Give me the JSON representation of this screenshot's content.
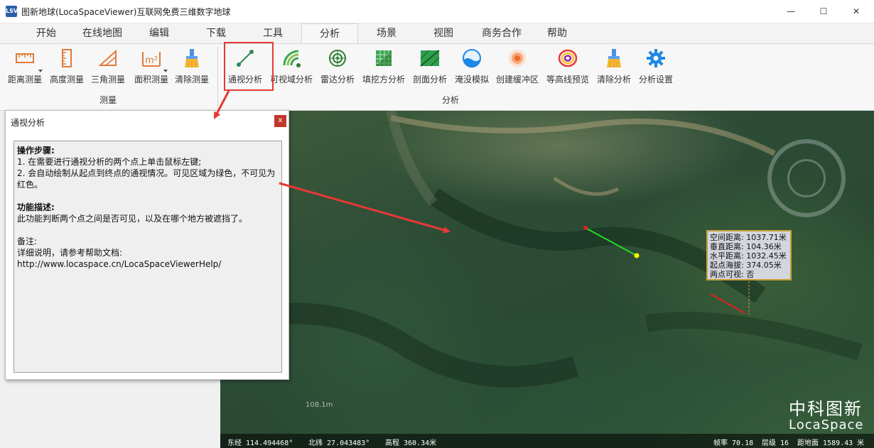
{
  "window": {
    "app_icon": "LSV",
    "title": "图新地球(LocaSpaceViewer)互联网免费三维数字地球",
    "minimize_glyph": "—",
    "maximize_glyph": "☐",
    "close_glyph": "✕"
  },
  "ribbon_tabs": [
    {
      "label": "开始"
    },
    {
      "label": "在线地图"
    },
    {
      "label": "编辑"
    },
    {
      "label": "下载"
    },
    {
      "label": "工具"
    },
    {
      "label": "分析",
      "active": true
    },
    {
      "label": "场景"
    },
    {
      "label": "视图"
    },
    {
      "label": "商务合作"
    },
    {
      "label": "帮助"
    }
  ],
  "measure_group": {
    "label": "测量",
    "buttons": [
      {
        "label": "距离测量",
        "icon": "ruler-icon"
      },
      {
        "label": "高度测量",
        "icon": "height-ruler-icon"
      },
      {
        "label": "三角测量",
        "icon": "triangle-ruler-icon"
      },
      {
        "label": "面积测量",
        "icon": "area-m2-icon"
      },
      {
        "label": "清除测量",
        "icon": "brush-clear-icon"
      }
    ],
    "area_icon_text": "m²"
  },
  "analysis_group": {
    "label": "分析",
    "buttons": [
      {
        "label": "通视分析",
        "icon": "line-of-sight-icon"
      },
      {
        "label": "可视域分析",
        "icon": "viewshed-icon"
      },
      {
        "label": "雷达分析",
        "icon": "radar-icon"
      },
      {
        "label": "填挖方分析",
        "icon": "cut-fill-icon"
      },
      {
        "label": "剖面分析",
        "icon": "profile-icon"
      },
      {
        "label": "淹没模拟",
        "icon": "flood-icon"
      },
      {
        "label": "创建缓冲区",
        "icon": "buffer-icon"
      },
      {
        "label": "等高线预览",
        "icon": "contour-icon"
      },
      {
        "label": "清除分析",
        "icon": "brush-clear-icon"
      },
      {
        "label": "分析设置",
        "icon": "gear-icon"
      }
    ]
  },
  "dialog": {
    "title": "通视分析",
    "close_label": "x",
    "steps_heading": "操作步骤:",
    "step1": "1. 在需要进行通视分析的两个点上单击鼠标左键;",
    "step2": "2. 会自动绘制从起点到终点的通视情况。可见区域为绿色，不可见为红色。",
    "desc_heading": "功能描述:",
    "desc_text": "此功能判断两个点之间是否可见，以及在哪个地方被遮挡了。",
    "notes_heading": "备注:",
    "notes_text": "详细说明，请参考帮助文档:",
    "help_url": "http://www.locaspace.cn/LocaSpaceViewerHelp/"
  },
  "map": {
    "info": {
      "spatial_distance": "空间距离: 1037.71米",
      "vertical_distance": "垂直距离: 104.36米",
      "horizontal_distance": "水平距离: 1032.45米",
      "start_elevation": "起点海拔: 374.05米",
      "visible": "两点可视: 否"
    },
    "scale_label": "108.1m",
    "brand_cn": "中科图新",
    "brand_en": "LocaSpace",
    "status": {
      "longitude": "东经 114.494468°",
      "latitude": "北纬 27.043483°",
      "elevation": "高程 360.34米",
      "fps": "帧率 70.18",
      "level": "层级 16",
      "ground_distance": "距地面 1589.43 米"
    },
    "colors": {
      "visible_line": "#22dd22",
      "blocked_line": "#e02020",
      "start_point": "#e02020",
      "end_point": "#ffff00",
      "annotation_arrow": "#e53935"
    }
  }
}
